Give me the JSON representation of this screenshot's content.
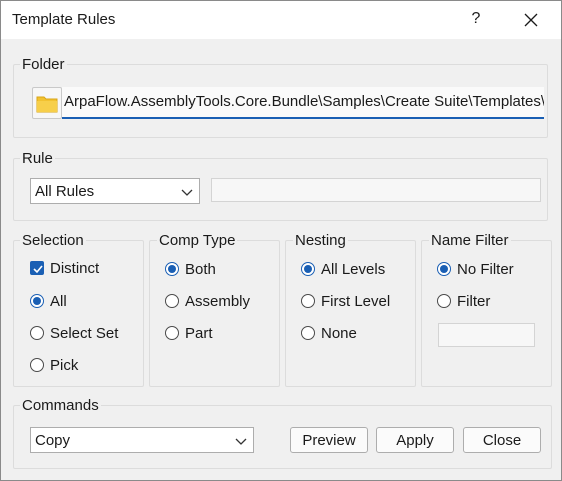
{
  "window": {
    "title": "Template Rules",
    "help_label": "?"
  },
  "folder": {
    "legend": "Folder",
    "path": "ArpaFlow.AssemblyTools.Core.Bundle\\Samples\\Create Suite\\Templates\\"
  },
  "rule": {
    "legend": "Rule",
    "selected": "All Rules",
    "text": ""
  },
  "selection": {
    "legend": "Selection",
    "distinct_label": "Distinct",
    "distinct_checked": true,
    "options": [
      "All",
      "Select Set",
      "Pick"
    ],
    "selected": "All"
  },
  "comp_type": {
    "legend": "Comp Type",
    "options": [
      "Both",
      "Assembly",
      "Part"
    ],
    "selected": "Both"
  },
  "nesting": {
    "legend": "Nesting",
    "options": [
      "All Levels",
      "First Level",
      "None"
    ],
    "selected": "All Levels"
  },
  "name_filter": {
    "legend": "Name Filter",
    "options": [
      "No Filter",
      "Filter"
    ],
    "selected": "No Filter",
    "filter_text": ""
  },
  "commands": {
    "legend": "Commands",
    "selected": "Copy",
    "preview_label": "Preview",
    "apply_label": "Apply",
    "close_label": "Close"
  },
  "colors": {
    "accent": "#1a5fb4",
    "folder_icon": "#f2c230"
  },
  "icons": {
    "folder": "folder-icon",
    "close": "close-icon",
    "chevron": "chevron-down-icon"
  }
}
